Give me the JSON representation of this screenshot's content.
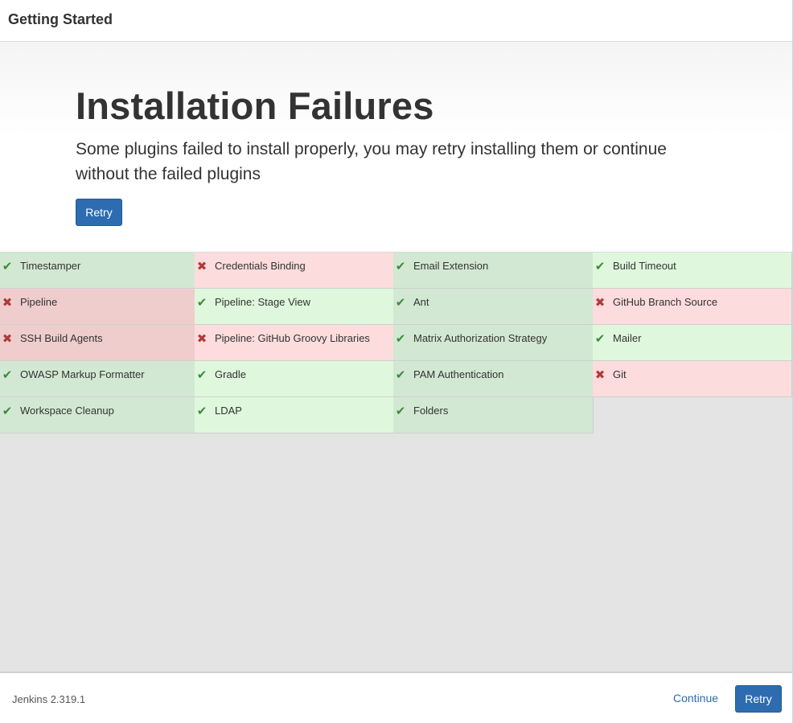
{
  "window": {
    "title": "Getting Started"
  },
  "hero": {
    "heading": "Installation Failures",
    "lead": "Some plugins failed to install properly, you may retry installing them or continue without the failed plugins",
    "retry_label": "Retry"
  },
  "plugins": [
    {
      "name": "Timestamper",
      "status": "success"
    },
    {
      "name": "Credentials Binding",
      "status": "fail"
    },
    {
      "name": "Email Extension",
      "status": "success"
    },
    {
      "name": "Build Timeout",
      "status": "success"
    },
    {
      "name": "Pipeline",
      "status": "fail"
    },
    {
      "name": "Pipeline: Stage View",
      "status": "success"
    },
    {
      "name": "Ant",
      "status": "success"
    },
    {
      "name": "GitHub Branch Source",
      "status": "fail"
    },
    {
      "name": "SSH Build Agents",
      "status": "fail"
    },
    {
      "name": "Pipeline: GitHub Groovy Libraries",
      "status": "fail"
    },
    {
      "name": "Matrix Authorization Strategy",
      "status": "success"
    },
    {
      "name": "Mailer",
      "status": "success"
    },
    {
      "name": "OWASP Markup Formatter",
      "status": "success"
    },
    {
      "name": "Gradle",
      "status": "success"
    },
    {
      "name": "PAM Authentication",
      "status": "success"
    },
    {
      "name": "Git",
      "status": "fail"
    },
    {
      "name": "Workspace Cleanup",
      "status": "success"
    },
    {
      "name": "LDAP",
      "status": "success"
    },
    {
      "name": "Folders",
      "status": "success"
    }
  ],
  "icons": {
    "success": "check-icon",
    "fail": "cross-icon"
  },
  "colors": {
    "accent": "#2d6cb0",
    "success_bg": "#dff8dd",
    "fail_bg": "#fcdcdc",
    "success_icon": "#3d8b3d",
    "fail_icon": "#b03a3a"
  },
  "footer": {
    "version": "Jenkins 2.319.1",
    "continue_label": "Continue",
    "retry_label": "Retry"
  }
}
